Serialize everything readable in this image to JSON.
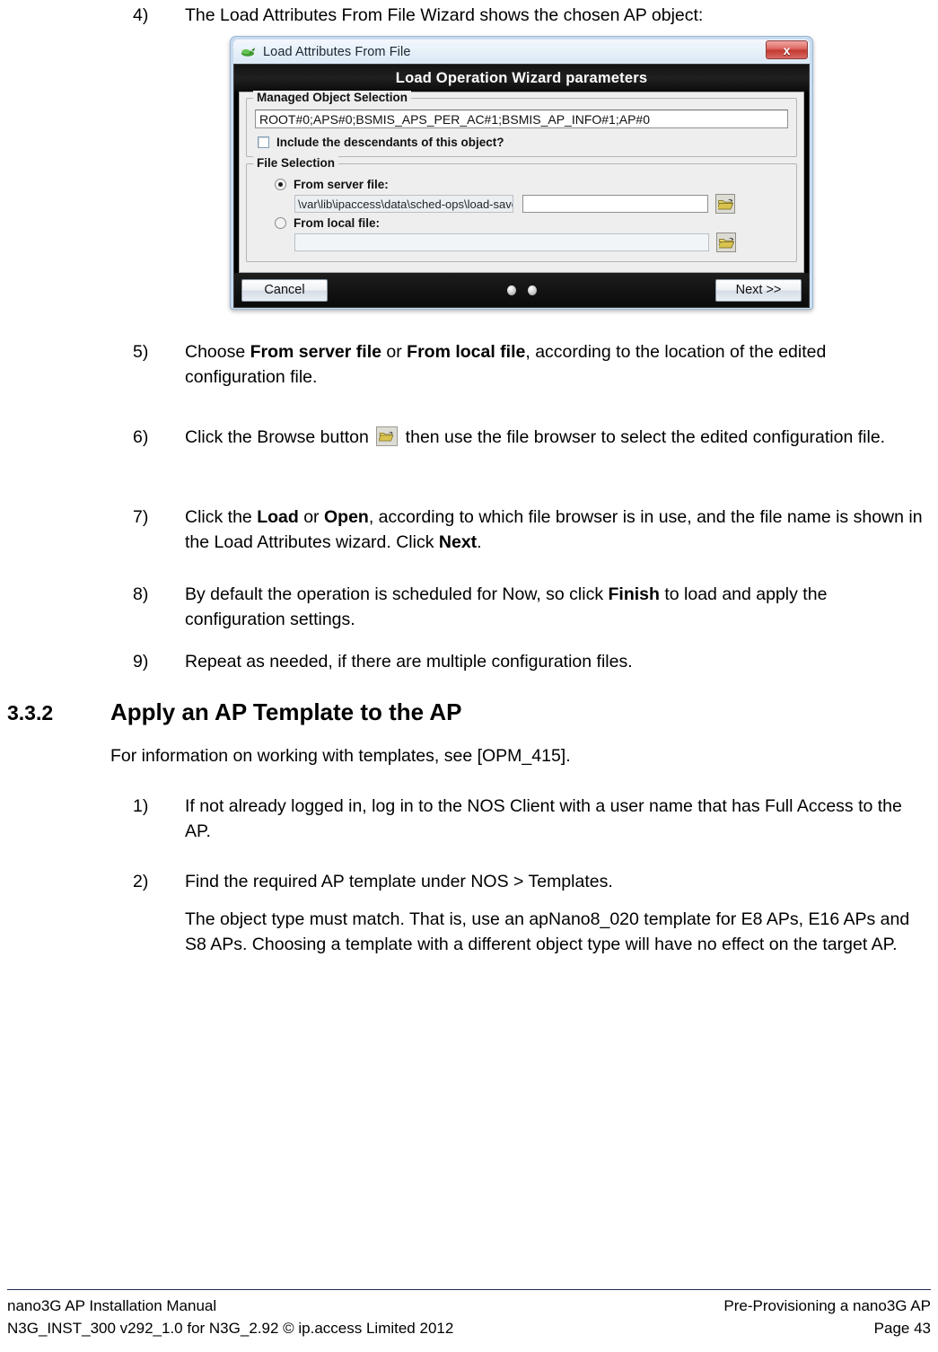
{
  "document": {
    "steps_before": [
      {
        "num": "4)",
        "text": "The Load Attributes From File Wizard shows the chosen AP object:"
      }
    ],
    "steps_after": [
      {
        "num": "5)",
        "line1_pre": "Choose ",
        "b1": "From server file",
        "mid1": " or ",
        "b2": "From local file",
        "line1_post": ", according to the location of the edited",
        "line2": "configuration file."
      },
      {
        "num": "6)",
        "line1_pre": "Click the Browse button ",
        "line1_post": " then use the file browser to select the edited",
        "line2": "configuration file."
      },
      {
        "num": "7)",
        "line1_pre": "Click the ",
        "b1": "Load",
        "mid1": " or ",
        "b2": "Open",
        "line1_post": ", according to which file browser is in use, and the file",
        "line2_pre": "name is shown in the Load Attributes wizard. Click ",
        "b3": "Next",
        "line2_post": "."
      },
      {
        "num": "8)",
        "line1_pre": "By default the operation is scheduled for Now, so click ",
        "b1": "Finish",
        "line1_post": " to load and apply the",
        "line2": "configuration settings."
      },
      {
        "num": "9)",
        "line1": "Repeat as needed, if there are multiple configuration files."
      }
    ],
    "section": {
      "number": "3.3.2",
      "title": "Apply an AP Template to the AP",
      "intro": "For information on working with templates, see [OPM_415].",
      "steps": [
        {
          "num": "1)",
          "line1": "If not already logged in, log in to the NOS Client with a user name that has Full",
          "line2": "Access to the AP."
        },
        {
          "num": "2)",
          "line1": "Find the required AP template under NOS > Templates.",
          "para_line1": "The object type must match. That is, use an apNano8_020 template for E8 APs,",
          "para_line2": "E16 APs and S8 APs. Choosing a template with a different object type will have no",
          "para_line3": "effect on the target AP."
        }
      ]
    }
  },
  "dialog": {
    "window_title": "Load Attributes From File",
    "app_icon": "green-app-icon",
    "close_label": "x",
    "banner_title": "Load Operation Wizard parameters",
    "managed_object_group": {
      "label": "Managed Object Selection",
      "value": "ROOT#0;APS#0;BSMIS_APS_PER_AC#1;BSMIS_AP_INFO#1;AP#0",
      "checkbox_label": "Include the descendants of this object?",
      "checkbox_checked": false
    },
    "file_selection_group": {
      "label": "File Selection",
      "server_option": {
        "label": "From server file:",
        "selected": true,
        "path_prefix": "\\var\\lib\\ipaccess\\data\\sched-ops\\load-save\\",
        "filename_value": "",
        "browse_icon": "open-folder-icon"
      },
      "local_option": {
        "label": "From local file:",
        "selected": false,
        "path_value": "",
        "browse_icon": "open-folder-icon"
      }
    },
    "buttons": {
      "cancel": "Cancel",
      "next": "Next >>"
    },
    "step_dots": 2
  },
  "footer": {
    "left_line1": "nano3G AP Installation Manual",
    "left_line2": "N3G_INST_300 v292_1.0 for N3G_2.92 © ip.access Limited 2012",
    "right_line1": "Pre-Provisioning a nano3G AP",
    "right_line2": "Page 43"
  },
  "colors": {
    "accent_dark": "#000000",
    "close_red": "#c33a32",
    "folder_yellow": "#d8c24a",
    "footer_rule": "#1f2a57"
  }
}
